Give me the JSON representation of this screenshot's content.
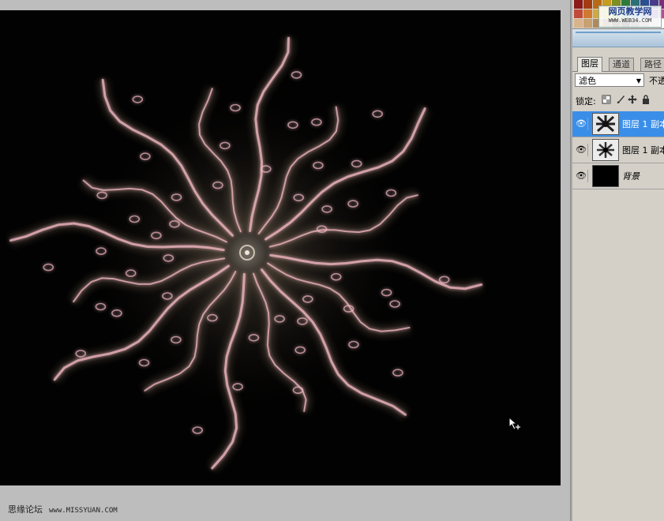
{
  "canvas": {
    "background_color": "#020202",
    "glow_color": "#f1b8c2"
  },
  "watermark": {
    "forum_name": "思缘论坛",
    "forum_url": "www.MISSYUAN.COM",
    "site_name": "网页教学网",
    "site_url": "WWW.WEB34.COM"
  },
  "swatch_colors": [
    "#8b1a1a",
    "#a33b12",
    "#b86a17",
    "#c79a20",
    "#7f8f22",
    "#2f7a3a",
    "#2d6f77",
    "#2b4f8f",
    "#4a3a8a",
    "#7a2f7a",
    "#c24a3a",
    "#d07a30",
    "#d4a83a",
    "#bfc24a",
    "#7fb25a",
    "#4aa08a",
    "#4a8fb0",
    "#4a6fc0",
    "#7a5ab0",
    "#b05090",
    "#d9b48a",
    "#c9a070",
    "#b08a5a",
    "#8a7050",
    "#5a4a3a",
    "#3a3a3a",
    "#6a6a6a",
    "#9a9a9a",
    "#c8c8c8",
    "#ffffff"
  ],
  "layers_panel": {
    "tabs": [
      {
        "label": "图层"
      },
      {
        "label": "通道"
      },
      {
        "label": "路径"
      }
    ],
    "blend_mode": "滤色",
    "opacity_label": "不透",
    "lock_label": "锁定:",
    "lock_icons": [
      "transparency-lock-icon",
      "brush-lock-icon",
      "move-lock-icon",
      "padlock-icon"
    ],
    "layers": [
      {
        "name": "图层 1 副本",
        "selected": true,
        "visible": true
      },
      {
        "name": "图层 1 副本",
        "selected": false,
        "visible": true
      },
      {
        "name": "背景",
        "selected": false,
        "visible": true
      }
    ],
    "selection_color": "#3a8ee8"
  }
}
